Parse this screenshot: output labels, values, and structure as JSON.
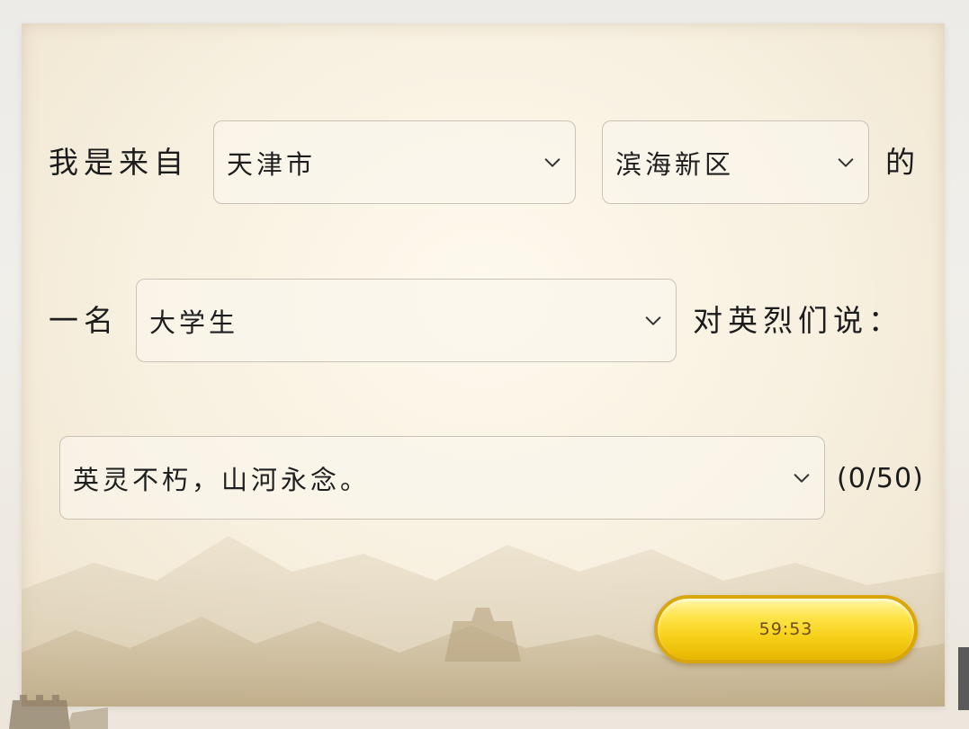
{
  "row1": {
    "prefix": "我是来自",
    "city": "天津市",
    "district": "滨海新区",
    "suffix": "的"
  },
  "row2": {
    "prefix": "一名",
    "identity": "大学生",
    "suffix": "对英烈们说："
  },
  "row3": {
    "message": "英灵不朽，山河永念。",
    "counter": "(0/50)"
  },
  "timer": {
    "label": "59:53"
  },
  "colors": {
    "paper": "#f7efdd",
    "button_gold": "#f7d21c",
    "button_border": "#d9a60c",
    "select_border": "#c9c2b5"
  },
  "icons": {
    "dropdown": "chevron-down-icon"
  }
}
